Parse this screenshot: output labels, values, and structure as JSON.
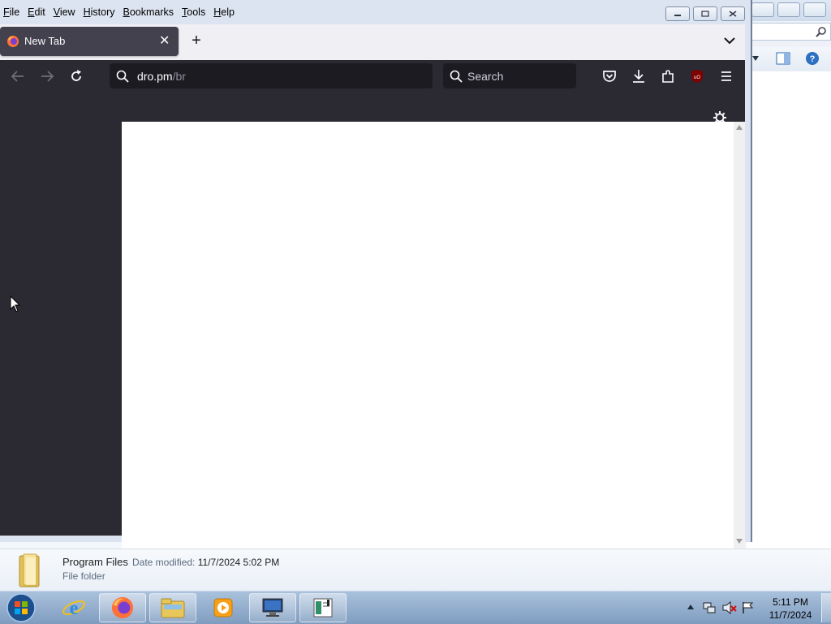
{
  "menu": {
    "items": [
      {
        "first": "F",
        "rest": "ile"
      },
      {
        "first": "E",
        "rest": "dit"
      },
      {
        "first": "V",
        "rest": "iew"
      },
      {
        "first": "H",
        "rest": "istory"
      },
      {
        "first": "B",
        "rest": "ookmarks"
      },
      {
        "first": "T",
        "rest": "ools"
      },
      {
        "first": "H",
        "rest": "elp"
      }
    ]
  },
  "tab": {
    "title": "New Tab",
    "close": "✕"
  },
  "newtab": "+",
  "urlbar": {
    "host": "dro.pm",
    "path": "/br"
  },
  "search": {
    "placeholder": "Search"
  },
  "details": {
    "name": "Program Files",
    "modified_label": "Date modified:",
    "modified_value": "11/7/2024 5:02 PM",
    "type": "File folder"
  },
  "clock": {
    "time": "5:11 PM",
    "date": "11/7/2024"
  },
  "icons": [
    "firefox-icon",
    "back-icon",
    "forward-icon",
    "reload-icon",
    "search-icon",
    "pocket-icon",
    "download-icon",
    "extensions-icon",
    "ublock-icon",
    "menu-icon",
    "gear-icon",
    "chevron-down-icon",
    "folder-icon",
    "start-orb-icon",
    "ie-icon",
    "explorer-icon",
    "media-player-icon",
    "remote-desktop-icon",
    "notepad-icon",
    "volume-mute-icon",
    "network-icon",
    "flag-icon"
  ],
  "colors": {
    "toolbar": "#2b2a33",
    "urlfield": "#1c1b22",
    "tab": "#42414d",
    "taskbar": "#8aa7c7"
  }
}
